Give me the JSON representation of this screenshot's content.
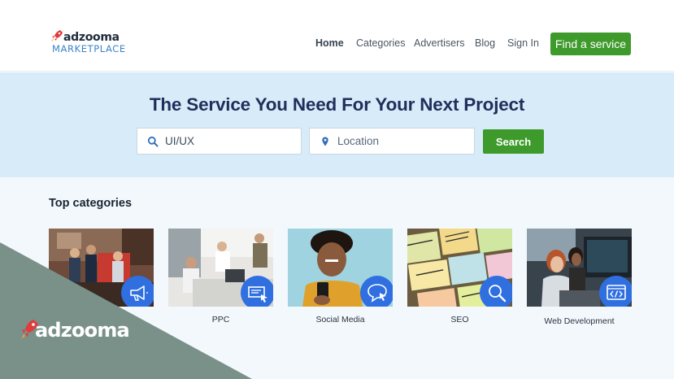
{
  "brand": {
    "name": "adzooma",
    "sub": "MARKETPLACE",
    "accent": "#3f9a2c",
    "hero_bg": "#d8ebf8",
    "overlay_color": "#7a918a"
  },
  "nav": {
    "items": [
      {
        "label": "Home",
        "active": true
      },
      {
        "label": "Categories",
        "active": false
      },
      {
        "label": "Advertisers",
        "active": false
      },
      {
        "label": "Blog",
        "active": false
      },
      {
        "label": "Sign In",
        "active": false
      }
    ],
    "cta": "Find a service"
  },
  "hero": {
    "title": "The Service You Need For Your Next Project",
    "search_value": "UI/UX",
    "location_placeholder": "Location",
    "search_button": "Search"
  },
  "categories": {
    "title": "Top categories",
    "items": [
      {
        "label": "",
        "icon": "megaphone-icon"
      },
      {
        "label": "PPC",
        "icon": "ad-click-icon"
      },
      {
        "label": "Social Media",
        "icon": "chat-bubble-icon"
      },
      {
        "label": "SEO",
        "icon": "magnifier-icon"
      },
      {
        "label": "Web Development",
        "icon": "code-window-icon"
      }
    ]
  },
  "overlay": {
    "word": "adzooma"
  }
}
